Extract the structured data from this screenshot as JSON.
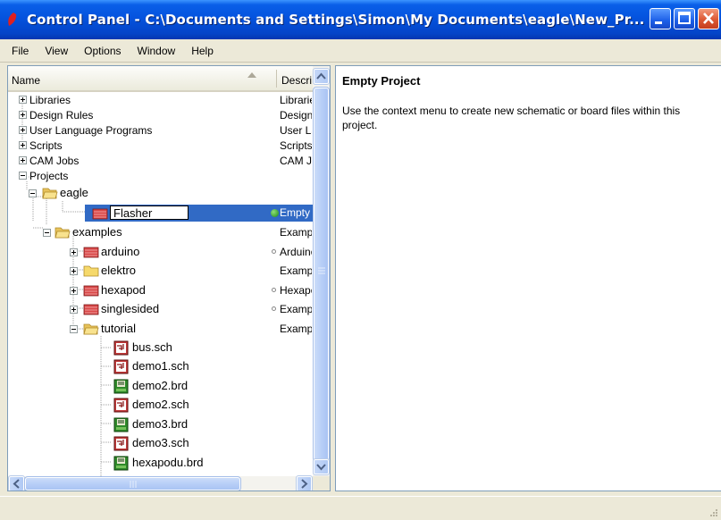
{
  "window": {
    "title": "Control Panel - C:\\Documents and Settings\\Simon\\My Documents\\eagle\\New_Pr..."
  },
  "menu": [
    "File",
    "View",
    "Options",
    "Window",
    "Help"
  ],
  "tree_header": {
    "name": "Name",
    "description": "Description"
  },
  "tree": {
    "libraries": {
      "label": "Libraries",
      "desc": "Libraries"
    },
    "design_rules": {
      "label": "Design Rules",
      "desc": "Design Rules"
    },
    "ulp": {
      "label": "User Language Programs",
      "desc": "User Language Programs"
    },
    "scripts": {
      "label": "Scripts",
      "desc": "Scripts"
    },
    "cam_jobs": {
      "label": "CAM Jobs",
      "desc": "CAM Jobs"
    },
    "projects": {
      "label": "Projects"
    },
    "eagle": {
      "label": "eagle"
    },
    "flasher": {
      "value": "Flasher",
      "desc": "Empty Project"
    },
    "examples": {
      "label": "examples",
      "desc": "Examples"
    },
    "arduino": {
      "label": "arduino",
      "desc": "Arduino"
    },
    "elektro": {
      "label": "elektro",
      "desc": "Example"
    },
    "hexapod": {
      "label": "hexapod",
      "desc": "Hexapod"
    },
    "singlesided": {
      "label": "singlesided",
      "desc": "Example"
    },
    "tutorial": {
      "label": "tutorial",
      "desc": "Example"
    },
    "files": [
      "bus.sch",
      "demo1.sch",
      "demo2.brd",
      "demo2.sch",
      "demo3.brd",
      "demo3.sch",
      "hexapodu.brd"
    ]
  },
  "info": {
    "title": "Empty Project",
    "body": "Use the context menu to create new schematic or board files within this project."
  },
  "colors": {
    "selection": "#316ac5",
    "titlebar": "#0555e0",
    "folder": "#f5d76a",
    "project_folder": "#d94848"
  }
}
